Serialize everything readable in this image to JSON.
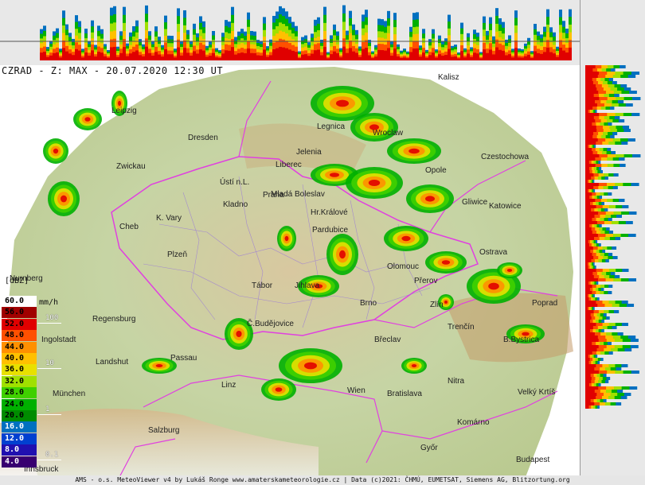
{
  "title": "CZRAD - Z: MAX - 20.07.2020 12:30 UT",
  "footer": "AMS - o.s. MeteoViewer v4 by Lukáš Ronge www.amaterskameteorologie.cz | Data (c)2021: ČHMÚ, EUMETSAT, Siemens AG, Blitzortung.org",
  "legend": {
    "unit_dbz": "[dBZ]",
    "unit_mmh": "mm/h",
    "levels": [
      {
        "dbz": "60.0",
        "color": "#ffffff",
        "text_color": "#000000"
      },
      {
        "dbz": "56.0",
        "color": "#a00000",
        "text_color": "#000000"
      },
      {
        "dbz": "52.0",
        "color": "#e00000",
        "text_color": "#000000"
      },
      {
        "dbz": "48.0",
        "color": "#ff5000",
        "text_color": "#000000"
      },
      {
        "dbz": "44.0",
        "color": "#ff9000",
        "text_color": "#000000"
      },
      {
        "dbz": "40.0",
        "color": "#ffc000",
        "text_color": "#000000"
      },
      {
        "dbz": "36.0",
        "color": "#e8e000",
        "text_color": "#000000"
      },
      {
        "dbz": "32.0",
        "color": "#a0e000",
        "text_color": "#000000"
      },
      {
        "dbz": "28.0",
        "color": "#40d000",
        "text_color": "#000000"
      },
      {
        "dbz": "24.0",
        "color": "#00b000",
        "text_color": "#000000"
      },
      {
        "dbz": "20.0",
        "color": "#008c00",
        "text_color": "#000000"
      },
      {
        "dbz": "16.0",
        "color": "#0070c0",
        "text_color": "#000000"
      },
      {
        "dbz": "12.0",
        "color": "#0040d0",
        "text_color": "#000000"
      },
      {
        "dbz": "8.0",
        "color": "#2010b0",
        "text_color": "#000000"
      },
      {
        "dbz": "4.0",
        "color": "#380070",
        "text_color": "#000000"
      }
    ],
    "mmh_ticks": [
      "100",
      "10",
      "1",
      "0.1"
    ]
  },
  "cities": [
    "Kalisz",
    "Leipzig",
    "Dresden",
    "Jelenia",
    "Legnica",
    "Wroclaw",
    "Opole",
    "Czestochowa",
    "Zwickau",
    "Gliwice",
    "Katowice",
    "Ústí n.L.",
    "Liberec",
    "Praha",
    "Pardubice",
    "Ostrava",
    "K. Vary",
    "Cheb",
    "Plzeň",
    "Kladno",
    "Mladá Boleslav",
    "Hr.Králové",
    "Olomouc",
    "Brno",
    "Zlín",
    "Nurnberg",
    "Jihlava",
    "Přerov",
    "Regensburg",
    "Ingolstadt",
    "Landshut",
    "Passau",
    "Č.Budějovice",
    "Linz",
    "München",
    "Trenčín",
    "B.Bystrica",
    "Poprad",
    "Břeclav",
    "Wien",
    "Bratislava",
    "Nitra",
    "Velký Krtíš",
    "Salzburg",
    "Komárno",
    "Győr",
    "Budapest",
    "Innsbruck",
    "Tábor"
  ],
  "colors": {
    "terrain_low": "#c8d8a8",
    "terrain_high": "#c89a6a",
    "border": "#e040e0",
    "district": "#9a7ad8"
  }
}
